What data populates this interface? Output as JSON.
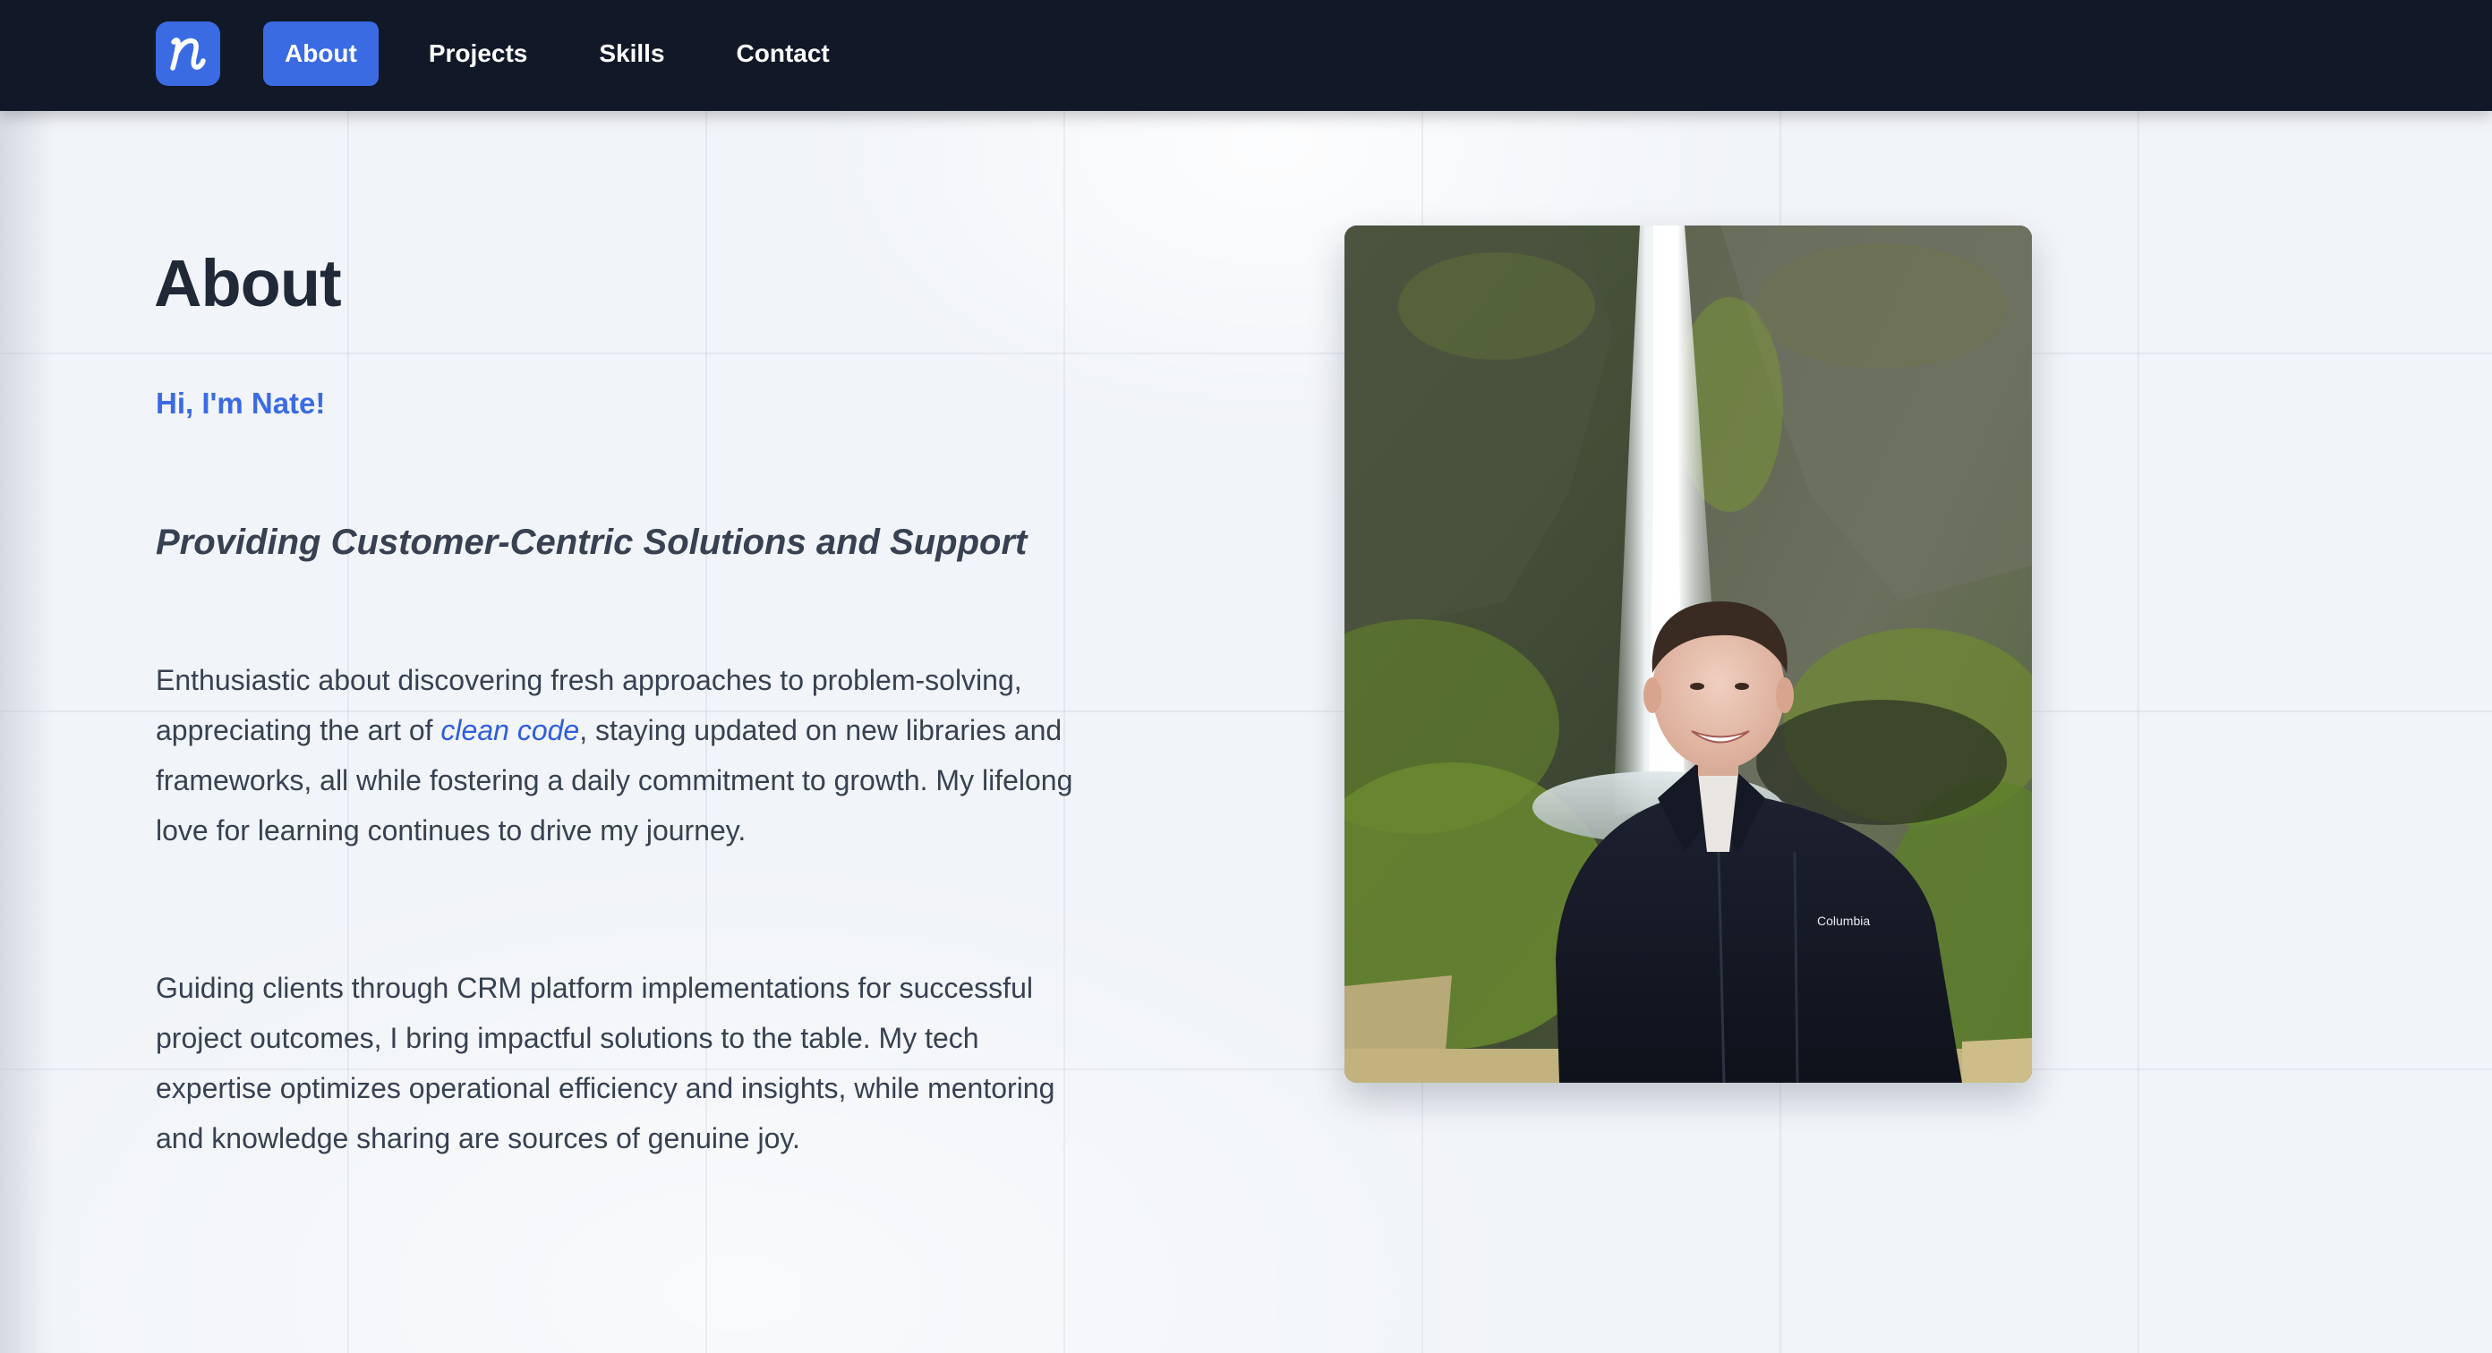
{
  "nav": {
    "logo_icon": "n-logo-icon",
    "items": [
      {
        "label": "About",
        "active": true
      },
      {
        "label": "Projects",
        "active": false
      },
      {
        "label": "Skills",
        "active": false
      },
      {
        "label": "Contact",
        "active": false
      }
    ]
  },
  "about": {
    "title": "About",
    "greeting": "Hi, I'm Nate!",
    "tagline": "Providing Customer-Centric Solutions and Support",
    "paragraph1": {
      "before_link": "Enthusiastic about discovering fresh approaches to problem-solving, appreciating the art of ",
      "link_text": "clean code",
      "after_link": ", staying updated on new libraries and frameworks, all while fostering a daily commitment to growth. My lifelong love for learning continues to drive my journey."
    },
    "paragraph2": "Guiding clients through CRM platform implementations for successful project outcomes, I bring impactful solutions to the table. My tech expertise optimizes operational efficiency and insights, while mentoring and knowledge sharing are sources of genuine joy."
  },
  "photo": {
    "jacket_brand_text": "Columbia"
  },
  "colors": {
    "nav_background": "#111827",
    "accent": "#3b6be3",
    "page_background": "#f1f4f8",
    "heading": "#1f2937",
    "body_text": "#374151"
  }
}
